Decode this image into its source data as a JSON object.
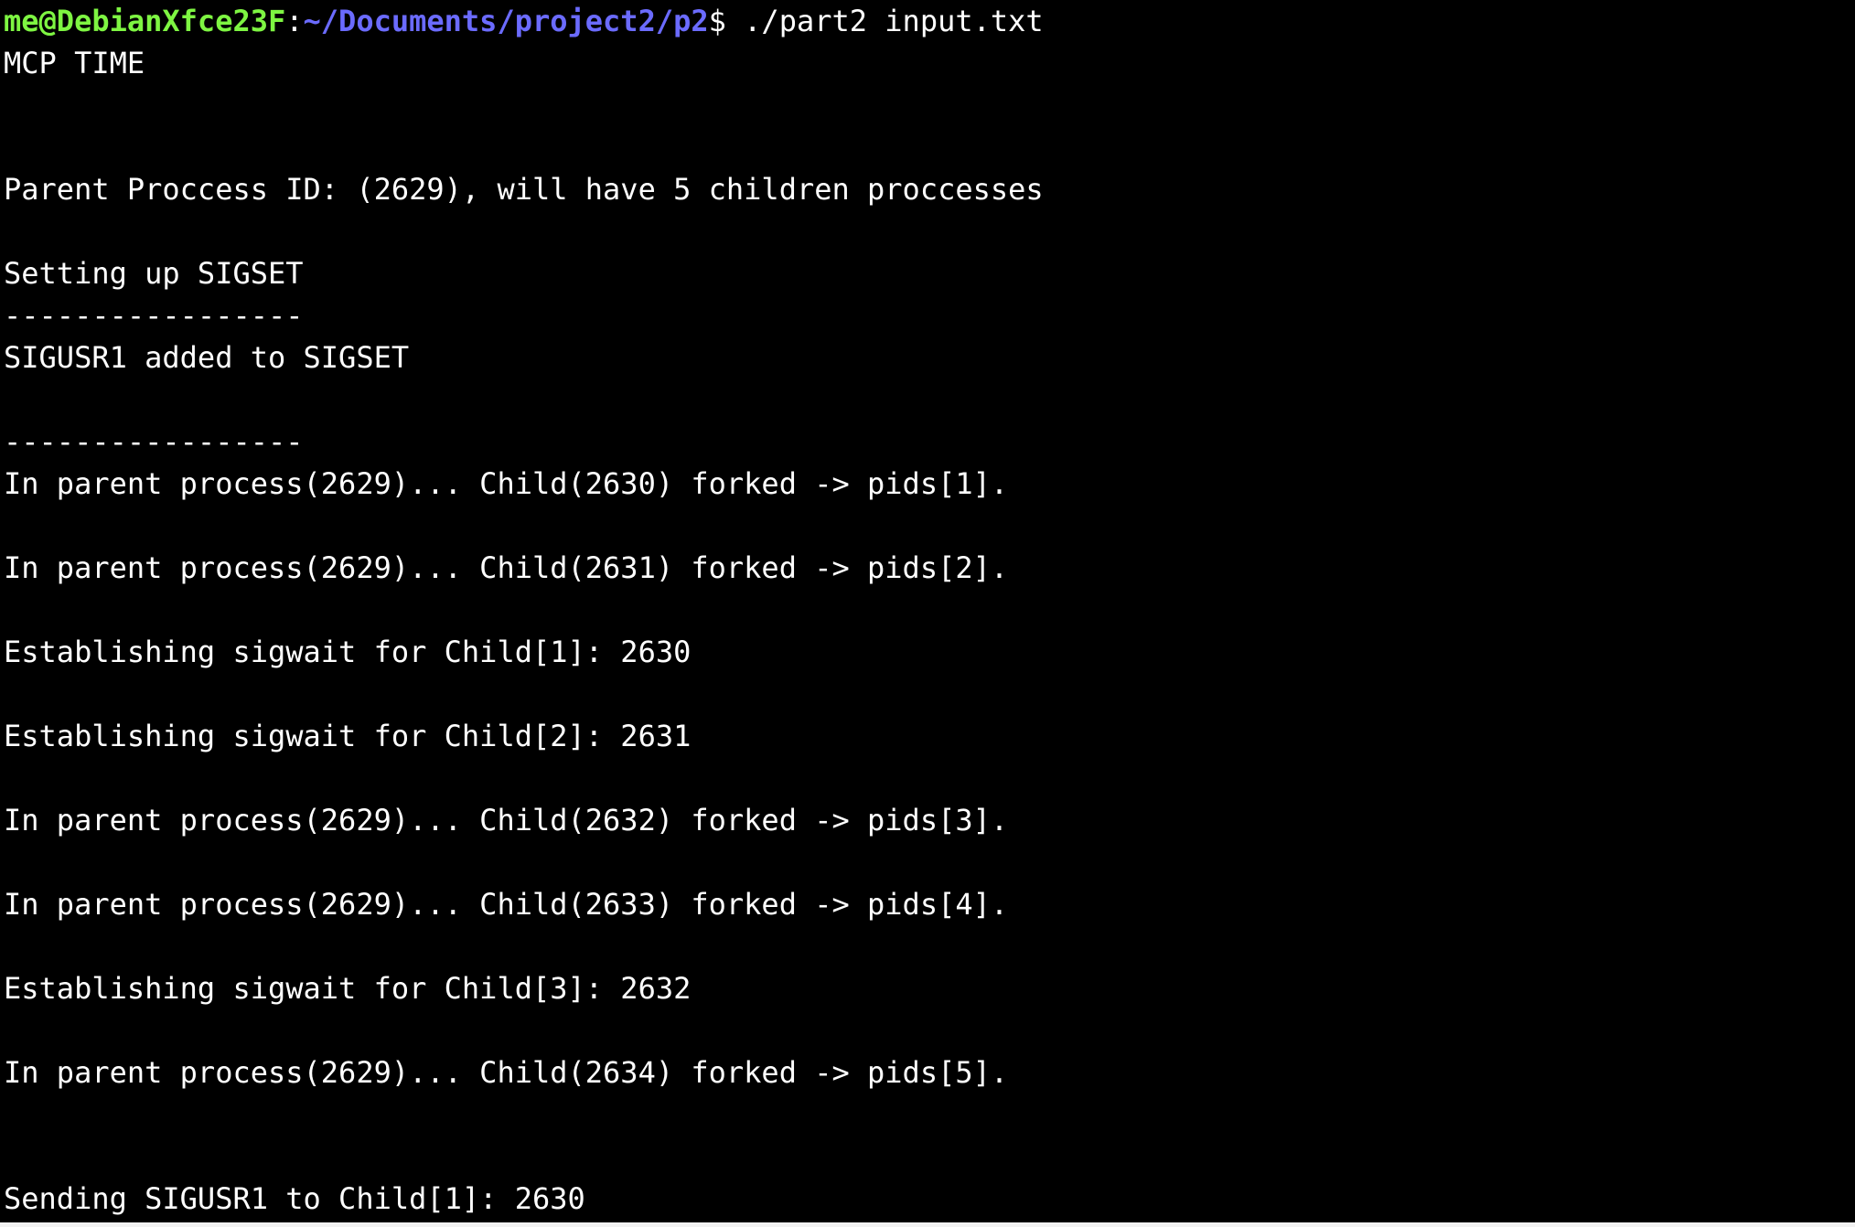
{
  "prompt": {
    "user_host": "me@DebianXfce23F",
    "colon": ":",
    "path": "~/Documents/project2/p2",
    "dollar": "$",
    "command": " ./part2 input.txt"
  },
  "output_lines": [
    "MCP TIME",
    "",
    "",
    "Parent Proccess ID: (2629), will have 5 children proccesses",
    "",
    "Setting up SIGSET",
    "-----------------",
    "SIGUSR1 added to SIGSET",
    "",
    "-----------------",
    "In parent process(2629)... Child(2630) forked -> pids[1].",
    "",
    "In parent process(2629)... Child(2631) forked -> pids[2].",
    "",
    "Establishing sigwait for Child[1]: 2630",
    "",
    "Establishing sigwait for Child[2]: 2631",
    "",
    "In parent process(2629)... Child(2632) forked -> pids[3].",
    "",
    "In parent process(2629)... Child(2633) forked -> pids[4].",
    "",
    "Establishing sigwait for Child[3]: 2632",
    "",
    "In parent process(2629)... Child(2634) forked -> pids[5].",
    "",
    "",
    "Sending SIGUSR1 to Child[1]: 2630"
  ],
  "colors": {
    "background": "#000000",
    "text": "#ffffff",
    "prompt_user": "#7ef542",
    "prompt_path": "#6b6bff"
  }
}
